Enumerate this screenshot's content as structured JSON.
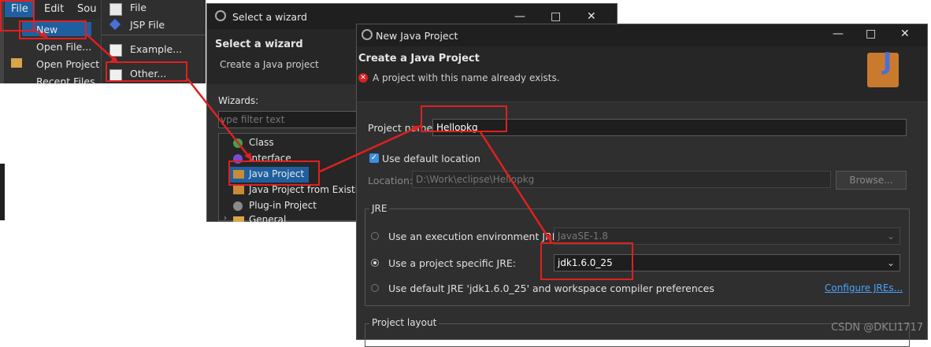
{
  "menubar": {
    "file": "File",
    "edit": "Edit",
    "source": "Sou"
  },
  "file_menu": {
    "new": "New",
    "open_file": "Open File...",
    "open_project": "Open Project",
    "recent_files": "Recent Files"
  },
  "new_submenu": {
    "file": "File",
    "jsp_file": "JSP File",
    "example": "Example...",
    "other": "Other..."
  },
  "wizard_dialog": {
    "title": "Select a wizard",
    "heading": "Select a wizard",
    "subheading": "Create a Java project",
    "wizards_label": "Wizards:",
    "filter_placeholder": "ype filter text",
    "items": [
      "Class",
      "Interface",
      "Java Project",
      "Java Project from Existin",
      "Plug-in Project",
      "General"
    ],
    "partial_right": "v"
  },
  "njp_dialog": {
    "title": "New Java Project",
    "heading": "Create a Java Project",
    "error": "A project with this name already exists.",
    "project_name_label": "Project name:",
    "project_name_value": "Hellopkg",
    "use_default_location": "Use default location",
    "location_label": "Location:",
    "location_value": "D:\\Work\\eclipse\\Hellopkg",
    "browse": "Browse...",
    "jre_group": "JRE",
    "exec_env_label": "Use an execution environment JRE:",
    "exec_env_value": "JavaSE-1.8",
    "specific_jre_label": "Use a project specific JRE:",
    "specific_jre_value": "jdk1.6.0_25",
    "default_jre_text": "Use default JRE 'jdk1.6.0_25' and workspace compiler preferences",
    "configure_jres": "Configure JREs...",
    "project_layout": "Project layout"
  },
  "colors": {
    "annotation_red": "#e02020",
    "link_blue": "#4aa3ff",
    "selection_blue": "#1f5f9f",
    "checkbox_blue": "#3d8ee0"
  },
  "watermark": "CSDN @DKLI1717"
}
